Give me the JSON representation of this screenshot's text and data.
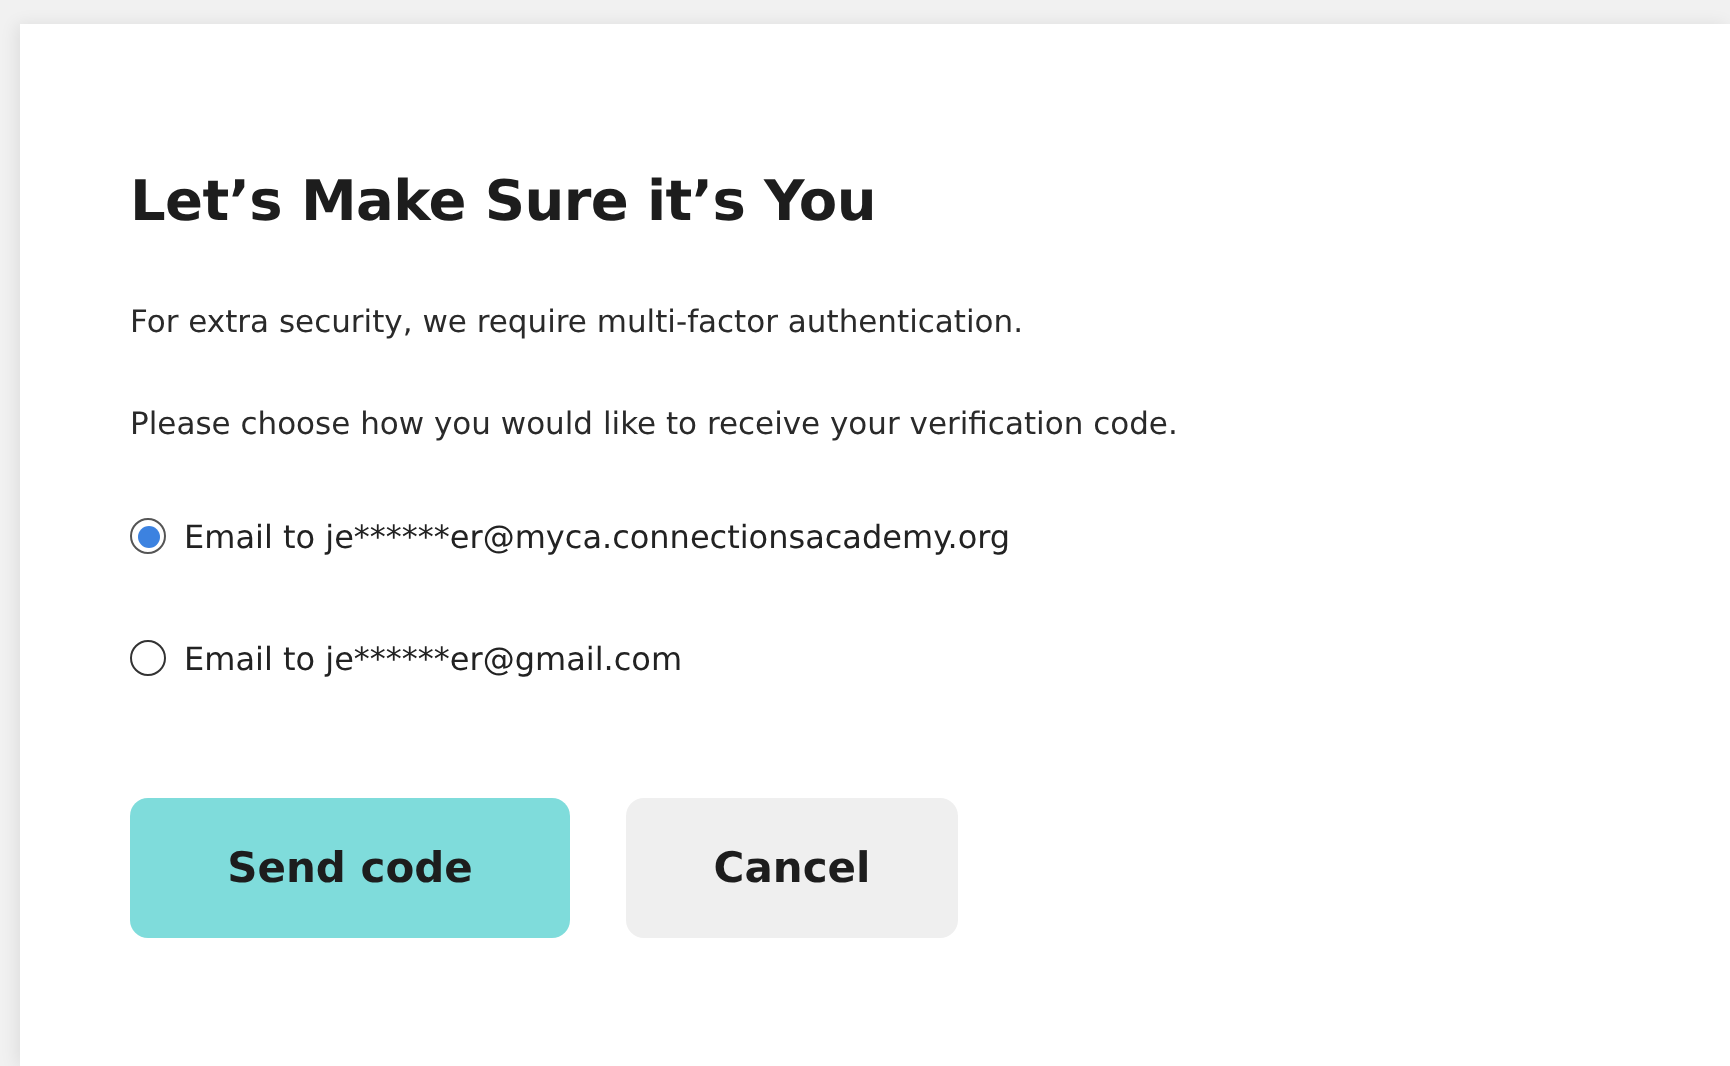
{
  "dialog": {
    "title": "Let’s Make Sure it’s You",
    "paragraphs": [
      "For extra security, we require multi-factor authentication.",
      "Please choose how you would like to receive your verification code."
    ],
    "options": [
      {
        "label": "Email to je******er@myca.connectionsacademy.org",
        "selected": true
      },
      {
        "label": "Email to je******er@gmail.com",
        "selected": false
      }
    ],
    "buttons": [
      {
        "label": "Send code",
        "kind": "primary"
      },
      {
        "label": "Cancel",
        "kind": "secondary"
      }
    ]
  }
}
